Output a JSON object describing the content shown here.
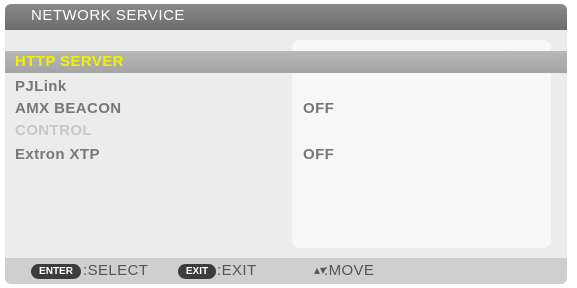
{
  "window": {
    "title": "NETWORK SERVICE"
  },
  "menu": {
    "items": [
      {
        "label": "HTTP SERVER",
        "value": ""
      },
      {
        "label": "PJLink",
        "value": ""
      },
      {
        "label": "AMX BEACON",
        "value": "OFF"
      },
      {
        "label": "CONTROL",
        "value": ""
      },
      {
        "label": "Extron XTP",
        "value": "OFF"
      }
    ]
  },
  "footer": {
    "enter_key": "ENTER",
    "enter_label": ":SELECT",
    "exit_key": "EXIT",
    "exit_label": ":EXIT",
    "move_icon": "up-down-arrows-icon",
    "move_label": ":MOVE"
  }
}
